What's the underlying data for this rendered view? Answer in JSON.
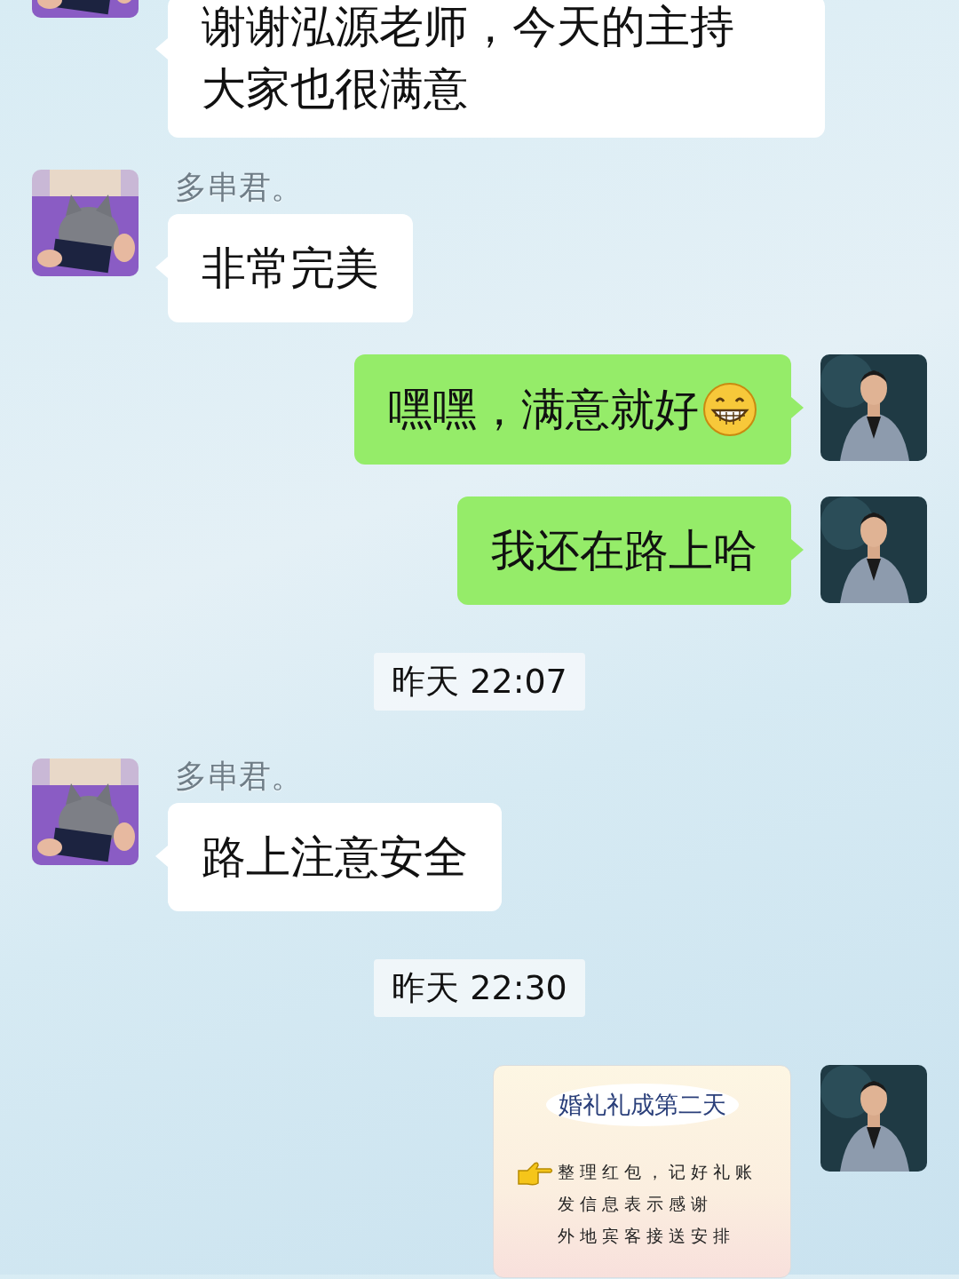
{
  "messages": [
    {
      "kind": "text",
      "outgoing": false,
      "text": "谢谢泓源老师，今天的主持大家也很满意"
    },
    {
      "kind": "text",
      "outgoing": false,
      "sender": "多串君。",
      "text": "非常完美"
    },
    {
      "kind": "text",
      "outgoing": true,
      "text": "嘿嘿，满意就好",
      "emoji": true
    },
    {
      "kind": "text",
      "outgoing": true,
      "text": "我还在路上哈"
    },
    {
      "kind": "time",
      "text": "昨天 22:07"
    },
    {
      "kind": "text",
      "outgoing": false,
      "sender": "多串君。",
      "text": "路上注意安全"
    },
    {
      "kind": "time",
      "text": "昨天 22:30"
    },
    {
      "kind": "card",
      "outgoing": true,
      "title": "婚礼礼成第二天",
      "lines": [
        "整理红包，记好礼账",
        "发信息表示感谢",
        "外地宾客接送安排"
      ]
    }
  ]
}
